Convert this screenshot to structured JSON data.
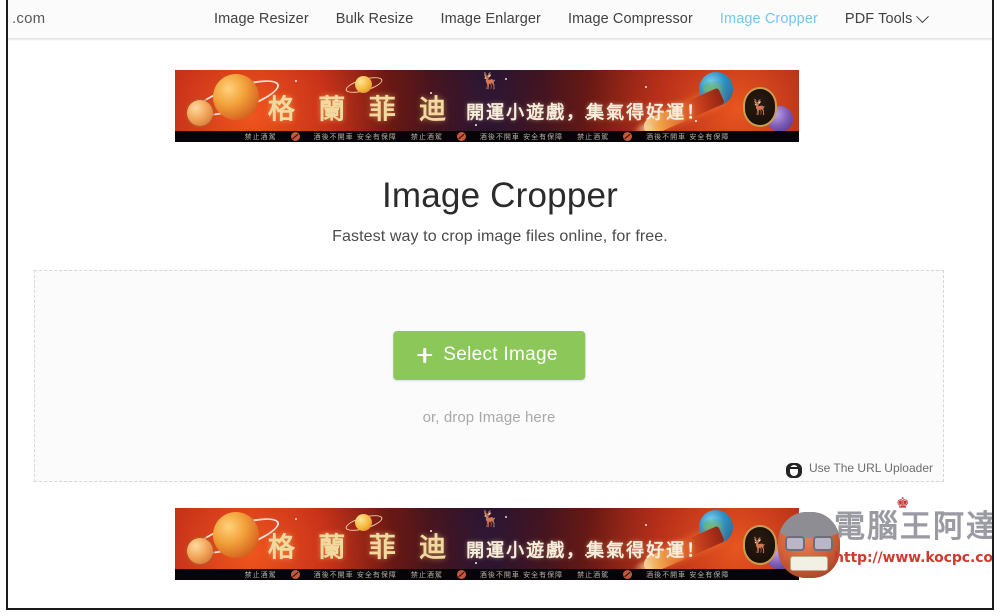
{
  "header": {
    "brand_partial": ".com",
    "nav_items": [
      {
        "label": "Image Resizer",
        "active": false,
        "dropdown": false
      },
      {
        "label": "Bulk Resize",
        "active": false,
        "dropdown": false
      },
      {
        "label": "Image Enlarger",
        "active": false,
        "dropdown": false
      },
      {
        "label": "Image Compressor",
        "active": false,
        "dropdown": false
      },
      {
        "label": "Image Cropper",
        "active": true,
        "dropdown": false
      },
      {
        "label": "PDF Tools",
        "active": false,
        "dropdown": true
      }
    ]
  },
  "main": {
    "title": "Image Cropper",
    "subtitle": "Fastest way to crop image files online, for free.",
    "dropzone": {
      "select_button_label": "Select Image",
      "drop_hint": "or, drop Image here",
      "url_uploader_label": "Use The URL Uploader"
    }
  },
  "ads": {
    "top_banner": {
      "brand_cn": "格 蘭 菲 迪",
      "slogan_cn": "開運小遊戲，集氣得好運！",
      "legal_1": "禁止酒駕",
      "legal_2": "酒後不開車 安全有保障",
      "legal_3": "禁止酒駕",
      "legal_4": "酒後不開車 安全有保障"
    },
    "bottom_banner": {
      "brand_cn": "格 蘭 菲 迪",
      "slogan_cn": "開運小遊戲，集氣得好運！",
      "legal_1": "禁止酒駕",
      "legal_2": "酒後不開車 安全有保障",
      "legal_3": "禁止酒駕",
      "legal_4": "酒後不開車 安全有保障"
    }
  },
  "watermark": {
    "site_name_cn": "電腦王阿達",
    "site_url": "http://www.kocpc.com.tw"
  },
  "colors": {
    "accent_green": "#8cc75a",
    "active_nav_blue": "#74c7ef",
    "watermark_red": "#d0392e",
    "ad_gold": "#f2d9a0"
  }
}
